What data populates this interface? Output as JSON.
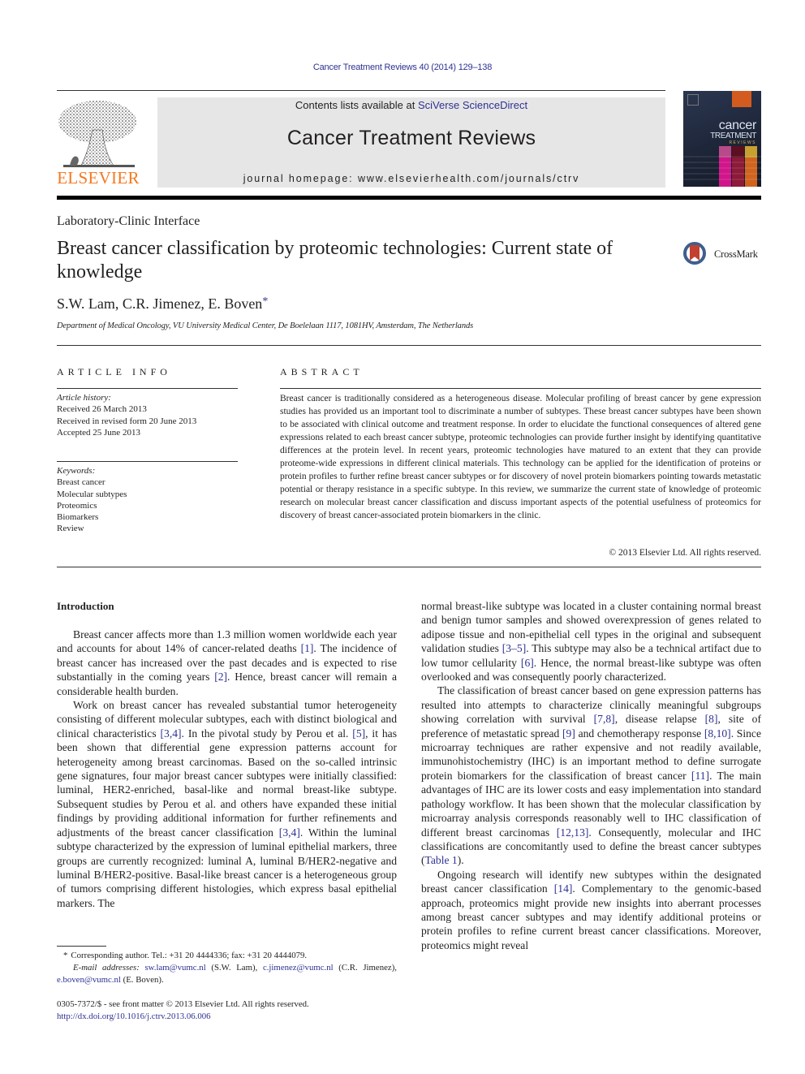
{
  "header": {
    "journal_reference": "Cancer Treatment Reviews 40 (2014) 129–138",
    "contents_prefix": "Contents lists available at ",
    "contents_link": "SciVerse ScienceDirect",
    "journal_title": "Cancer Treatment Reviews",
    "homepage_prefix": "journal homepage: ",
    "homepage_url": "www.elsevierhealth.com/journals/ctrv",
    "publisher_logo_text": "ELSEVIER",
    "cover": {
      "line1": "cancer",
      "line2": "TREATMENT",
      "line3": "REVIEWS"
    },
    "colors": {
      "link": "#2e3192",
      "elsevier_orange": "#f47920",
      "masthead_bg": "#e6e6e6"
    }
  },
  "article": {
    "section": "Laboratory-Clinic Interface",
    "title": "Breast cancer classification by proteomic technologies: Current state of knowledge",
    "crossmark_label": "CrossMark",
    "authors": "S.W. Lam, C.R. Jimenez, E. Boven",
    "corresponding_marker": "*",
    "affiliation": "Department of Medical Oncology, VU University Medical Center, De Boelelaan 1117, 1081HV, Amsterdam, The Netherlands"
  },
  "article_info": {
    "heading": "ARTICLE INFO",
    "history_label": "Article history:",
    "history": [
      "Received 26 March 2013",
      "Received in revised form 20 June 2013",
      "Accepted 25 June 2013"
    ],
    "keywords_label": "Keywords:",
    "keywords": [
      "Breast cancer",
      "Molecular subtypes",
      "Proteomics",
      "Biomarkers",
      "Review"
    ]
  },
  "abstract": {
    "heading": "ABSTRACT",
    "text": "Breast cancer is traditionally considered as a heterogeneous disease. Molecular profiling of breast cancer by gene expression studies has provided us an important tool to discriminate a number of subtypes. These breast cancer subtypes have been shown to be associated with clinical outcome and treatment response. In order to elucidate the functional consequences of altered gene expressions related to each breast cancer subtype, proteomic technologies can provide further insight by identifying quantitative differences at the protein level. In recent years, proteomic technologies have matured to an extent that they can provide proteome-wide expressions in different clinical materials. This technology can be applied for the identification of proteins or protein profiles to further refine breast cancer subtypes or for discovery of novel protein biomarkers pointing towards metastatic potential or therapy resistance in a specific subtype. In this review, we summarize the current state of knowledge of proteomic research on molecular breast cancer classification and discuss important aspects of the potential usefulness of proteomics for discovery of breast cancer-associated protein biomarkers in the clinic.",
    "copyright": "© 2013 Elsevier Ltd. All rights reserved."
  },
  "body": {
    "intro_heading": "Introduction",
    "left": {
      "p1": [
        "Breast cancer affects more than 1.3 million women worldwide each year and accounts for about 14% of cancer-related deaths ",
        "[1]",
        ". The incidence of breast cancer has increased over the past decades and is expected to rise substantially in the coming years ",
        "[2]",
        ". Hence, breast cancer will remain a considerable health burden."
      ],
      "p2": [
        "Work on breast cancer has revealed substantial tumor heterogeneity consisting of different molecular subtypes, each with distinct biological and clinical characteristics ",
        "[3,4]",
        ". In the pivotal study by Perou et al. ",
        "[5]",
        ", it has been shown that differential gene expression patterns account for heterogeneity among breast carcinomas. Based on the so-called intrinsic gene signatures, four major breast cancer subtypes were initially classified: luminal, HER2-enriched, basal-like and normal breast-like subtype. Subsequent studies by Perou et al. and others have expanded these initial findings by providing additional information for further refinements and adjustments of the breast cancer classification ",
        "[3,4]",
        ". Within the luminal subtype characterized by the expression of luminal epithelial markers, three groups are currently recognized: luminal A, luminal B/HER2-negative and luminal B/HER2-positive. Basal-like breast cancer is a heterogeneous group of tumors comprising different histologies, which express basal epithelial markers. The"
      ]
    },
    "right": {
      "p1": [
        "normal breast-like subtype was located in a cluster containing normal breast and benign tumor samples and showed overexpression of genes related to adipose tissue and non-epithelial cell types in the original and subsequent validation studies ",
        "[3–5]",
        ". This subtype may also be a technical artifact due to low tumor cellularity ",
        "[6]",
        ". Hence, the normal breast-like subtype was often overlooked and was consequently poorly characterized."
      ],
      "p2": [
        "The classification of breast cancer based on gene expression patterns has resulted into attempts to characterize clinically meaningful subgroups showing correlation with survival ",
        "[7,8]",
        ", disease relapse ",
        "[8]",
        ", site of preference of metastatic spread ",
        "[9]",
        " and chemotherapy response ",
        "[8,10]",
        ". Since microarray techniques are rather expensive and not readily available, immunohistochemistry (IHC) is an important method to define surrogate protein biomarkers for the classification of breast cancer ",
        "[11]",
        ". The main advantages of IHC are its lower costs and easy implementation into standard pathology workflow. It has been shown that the molecular classification by microarray analysis corresponds reasonably well to IHC classification of different breast carcinomas ",
        "[12,13]",
        ". Consequently, molecular and IHC classifications are concomitantly used to define the breast cancer subtypes (",
        "Table 1",
        ")."
      ],
      "p3": [
        "Ongoing research will identify new subtypes within the designated breast cancer classification ",
        "[14]",
        ". Complementary to the genomic-based approach, proteomics might provide new insights into aberrant processes among breast cancer subtypes and may identify additional proteins or protein profiles to refine current breast cancer classifications. Moreover, proteomics might reveal"
      ]
    }
  },
  "footnote": {
    "marker": "*",
    "corresponding": "Corresponding author. Tel.: +31 20 4444336; fax: +31 20 4444079.",
    "email_label": "E-mail addresses:",
    "emails": [
      {
        "address": "sw.lam@vumc.nl",
        "name": " (S.W. Lam), "
      },
      {
        "address": "c.jimenez@vumc.nl",
        "name": " (C.R. Jimenez), "
      },
      {
        "address": "e.boven@vumc.nl",
        "name": " (E. Boven)."
      }
    ]
  },
  "front_matter": {
    "issn_line": "0305-7372/$ - see front matter © 2013 Elsevier Ltd. All rights reserved.",
    "doi": "http://dx.doi.org/10.1016/j.ctrv.2013.06.006"
  }
}
